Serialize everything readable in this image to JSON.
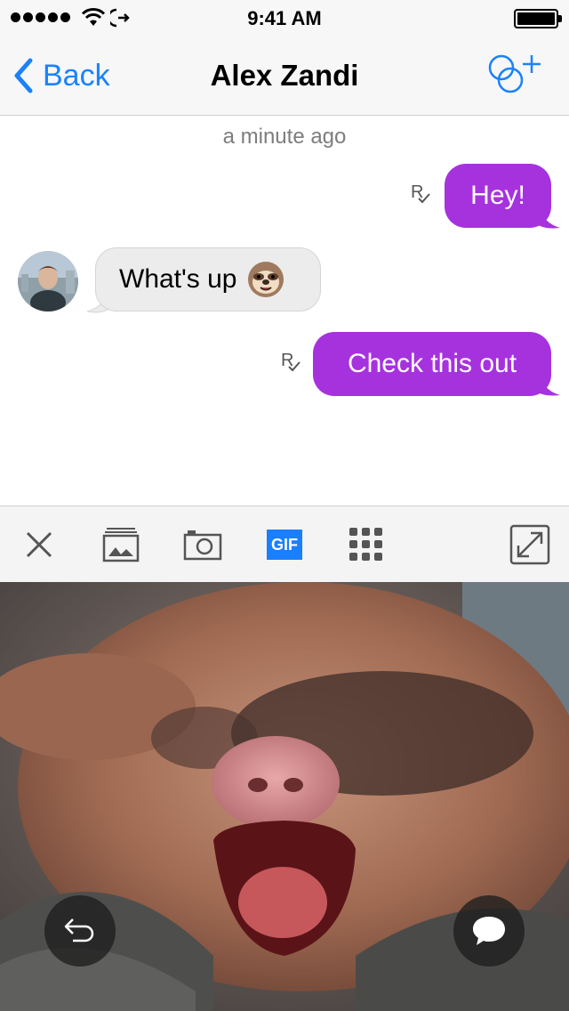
{
  "status_bar": {
    "time": "9:41 AM"
  },
  "nav": {
    "back_label": "Back",
    "title": "Alex Zandi",
    "accent_color": "#1a82fb"
  },
  "conversation": {
    "timestamp": "a minute ago",
    "messages": [
      {
        "direction": "outgoing",
        "text": "Hey!",
        "receipt": "R"
      },
      {
        "direction": "incoming",
        "text": "What's up",
        "emoji": "sloth-face"
      },
      {
        "direction": "outgoing",
        "text": "Check this out",
        "receipt": "R"
      }
    ],
    "outgoing_color": "#a632de",
    "incoming_color": "#ececec"
  },
  "toolbar": {
    "items": [
      {
        "icon": "close-icon"
      },
      {
        "icon": "photo-library-icon"
      },
      {
        "icon": "camera-icon"
      },
      {
        "label": "GIF",
        "selected": true
      },
      {
        "icon": "apps-grid-icon"
      },
      {
        "icon": "expand-icon"
      }
    ],
    "gif_color": "#1a7fff"
  },
  "media": {
    "icons": [
      "undo-icon",
      "chat-bubble-icon"
    ]
  }
}
